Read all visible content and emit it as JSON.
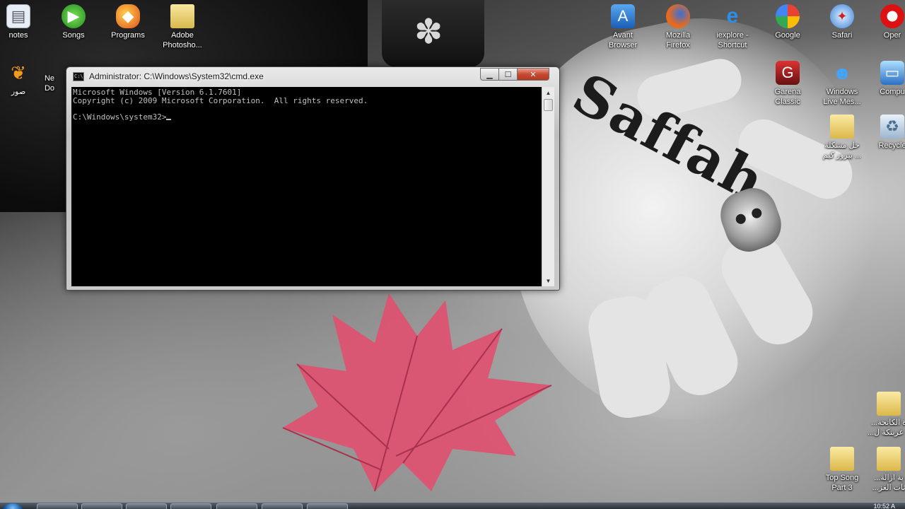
{
  "desktop": {
    "icons_left": [
      {
        "name": "notes",
        "label": "notes"
      },
      {
        "name": "songs",
        "label": "Songs"
      },
      {
        "name": "programs",
        "label": "Programs"
      },
      {
        "name": "adobe-photoshop",
        "label": "Adobe\nPhotosho..."
      },
      {
        "name": "pictures-arabic",
        "label": "صور"
      },
      {
        "name": "network",
        "label": "Ne\nDo"
      }
    ],
    "icons_right": [
      {
        "name": "avant-browser",
        "label": "Avant\nBrowser"
      },
      {
        "name": "mozilla-firefox",
        "label": "Mozilla\nFirefox"
      },
      {
        "name": "iexplore-shortcut",
        "label": "iexplore -\nShortcut"
      },
      {
        "name": "google",
        "label": "Google"
      },
      {
        "name": "safari",
        "label": "Safari"
      },
      {
        "name": "opera",
        "label": "Oper"
      },
      {
        "name": "garena-classic",
        "label": "Garena\nClassic"
      },
      {
        "name": "windows-live-messenger",
        "label": "Windows\nLive Mes..."
      },
      {
        "name": "computer",
        "label": "Compu"
      },
      {
        "name": "arabic-folder-1",
        "label": "حل مشكلة\nبيرور كيم ..."
      },
      {
        "name": "recycle-bin",
        "label": "Recycle"
      },
      {
        "name": "arabic-folder-2",
        "label": "...ة الكاتحة\n...ة عربنكة ل"
      },
      {
        "name": "top-song-part3",
        "label": "Top Song\nPart 3"
      },
      {
        "name": "arabic-folder-3",
        "label": "...ية ازالة\n...ثات الغز"
      }
    ]
  },
  "cmd_window": {
    "title": "Administrator: C:\\Windows\\System32\\cmd.exe",
    "title_icon_text": "C:\\",
    "lines": [
      "Microsoft Windows [Version 6.1.7601]",
      "Copyright (c) 2009 Microsoft Corporation.  All rights reserved.",
      "",
      "C:\\Windows\\system32>"
    ],
    "buttons": {
      "minimize": "▁",
      "maximize": "☐",
      "close": "✕"
    },
    "scroll_up": "▲",
    "scroll_down": "▼"
  },
  "wallpaper": {
    "tattoo_text": "Saffah",
    "leaf_color": "#e0506e"
  },
  "taskbar": {
    "clock": "10:52 A"
  }
}
